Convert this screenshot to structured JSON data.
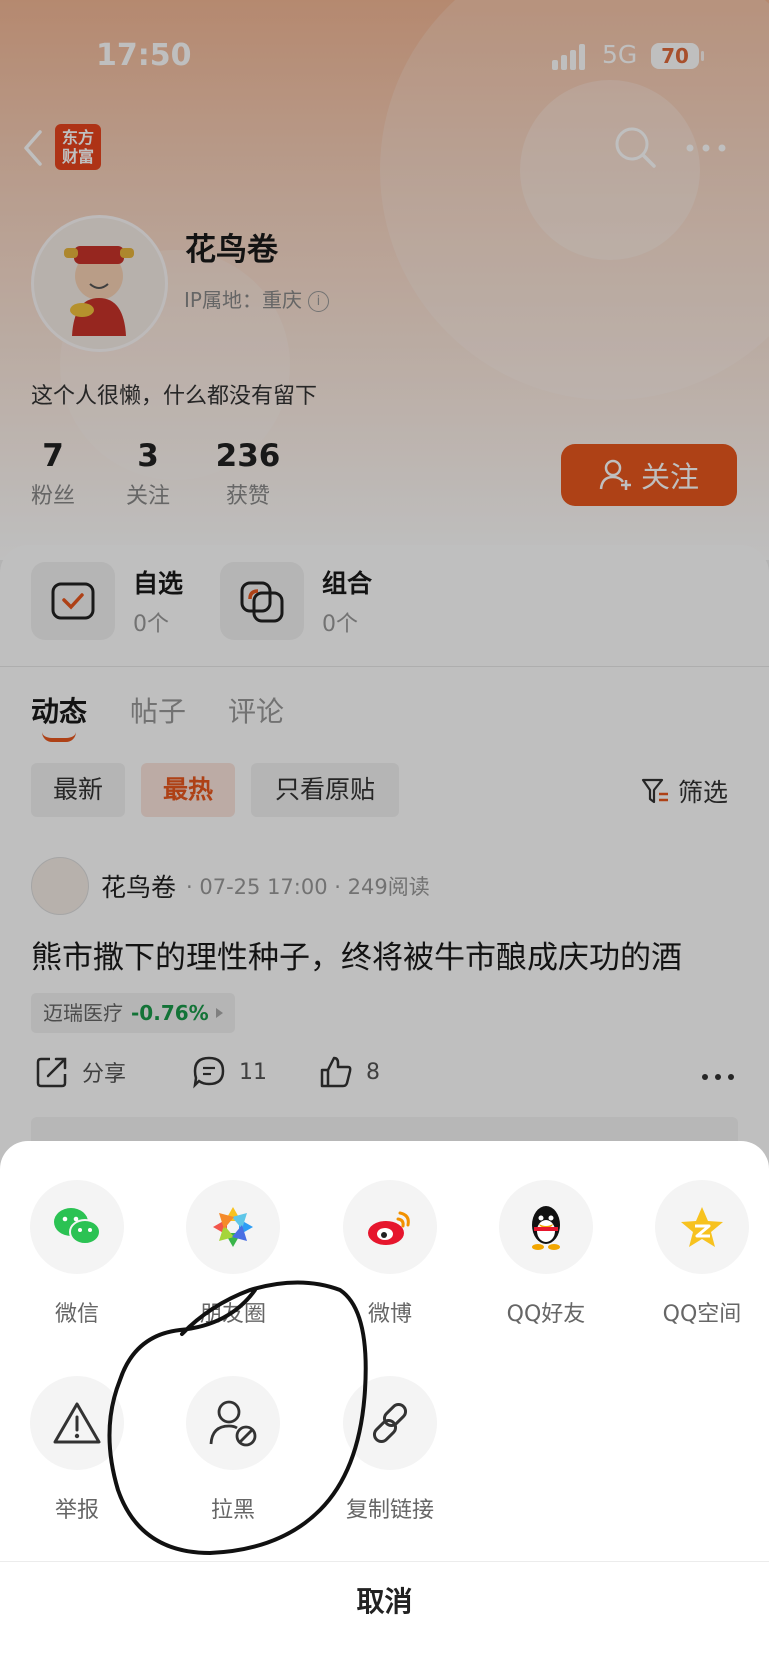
{
  "status_bar": {
    "time": "17:50",
    "network": "5G",
    "battery": "70"
  },
  "header": {
    "logo_text_line1": "东方",
    "logo_text_line2": "财富"
  },
  "profile": {
    "username": "花鸟卷",
    "ip_location": "IP属地：重庆",
    "bio": "这个人很懒，什么都没有留下",
    "stats": [
      {
        "value": "7",
        "label": "粉丝"
      },
      {
        "value": "3",
        "label": "关注"
      },
      {
        "value": "236",
        "label": "获赞"
      }
    ],
    "follow_label": "关注"
  },
  "favorites": [
    {
      "title": "自选",
      "count": "0个"
    },
    {
      "title": "组合",
      "count": "0个"
    }
  ],
  "tabs": [
    {
      "label": "动态",
      "active": true
    },
    {
      "label": "帖子",
      "active": false
    },
    {
      "label": "评论",
      "active": false
    }
  ],
  "filters": {
    "chips": [
      {
        "label": "最新",
        "active": false
      },
      {
        "label": "最热",
        "active": true
      },
      {
        "label": "只看原贴",
        "active": false
      }
    ],
    "filter_label": "筛选"
  },
  "post": {
    "author": "花鸟卷",
    "meta": "· 07-25 17:00 · 249阅读",
    "title": "熊市撒下的理性种子，终将被牛市酿成庆功的酒",
    "stock_name": "迈瑞医疗",
    "stock_change": "-0.76%",
    "share_label": "分享",
    "comment_count": "11",
    "like_count": "8"
  },
  "share_sheet": {
    "row1": [
      {
        "label": "微信",
        "icon": "wechat-icon"
      },
      {
        "label": "朋友圈",
        "icon": "moments-icon"
      },
      {
        "label": "微博",
        "icon": "weibo-icon"
      },
      {
        "label": "QQ好友",
        "icon": "qq-icon"
      },
      {
        "label": "QQ空间",
        "icon": "qzone-icon"
      }
    ],
    "row2": [
      {
        "label": "举报",
        "icon": "warning-icon"
      },
      {
        "label": "拉黑",
        "icon": "block-user-icon"
      },
      {
        "label": "复制链接",
        "icon": "link-icon"
      }
    ],
    "cancel_label": "取消"
  },
  "colors": {
    "accent": "#e8571e",
    "stock_down": "#1a9a4a"
  }
}
